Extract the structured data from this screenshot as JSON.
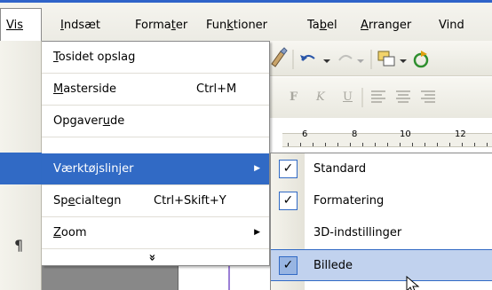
{
  "menubar": {
    "items": [
      "Vis",
      "Indsæt",
      "Formater",
      "Funktioner",
      "Tabel",
      "Arranger",
      "Vind"
    ]
  },
  "vis_menu": {
    "items": [
      {
        "pre": "",
        "u": "T",
        "post": "osidet opslag",
        "shortcut": ""
      },
      {
        "pre": "",
        "u": "M",
        "post": "asterside",
        "shortcut": "Ctrl+M"
      },
      {
        "pre": "Opgaver",
        "u": "u",
        "post": "de",
        "shortcut": ""
      },
      {
        "pre": "Værktøjslinjer",
        "u": "",
        "post": "",
        "shortcut": ""
      },
      {
        "pre": "Sp",
        "u": "e",
        "post": "cialtegn",
        "shortcut": "Ctrl+Skift+Y"
      },
      {
        "pre": "",
        "u": "Z",
        "post": "oom",
        "shortcut": ""
      }
    ],
    "expand_glyph": "»",
    "highlight_color": "#316ac5"
  },
  "toolbars_submenu": {
    "items": [
      {
        "label": "Standard",
        "checked": true
      },
      {
        "label": "Formatering",
        "checked": true
      },
      {
        "label": "3D-indstillinger",
        "checked": false
      },
      {
        "label": "Billede",
        "checked": true
      }
    ],
    "highlight_color": "#c1d2ee"
  },
  "toolbar": {
    "format_buttons": [
      "F",
      "K",
      "U"
    ]
  },
  "ruler": {
    "numbers": [
      "6",
      "8",
      "10",
      "12"
    ]
  },
  "icons": {
    "pilcrow": "¶",
    "checkmark": "✓",
    "submenu_arrow": "▶"
  }
}
